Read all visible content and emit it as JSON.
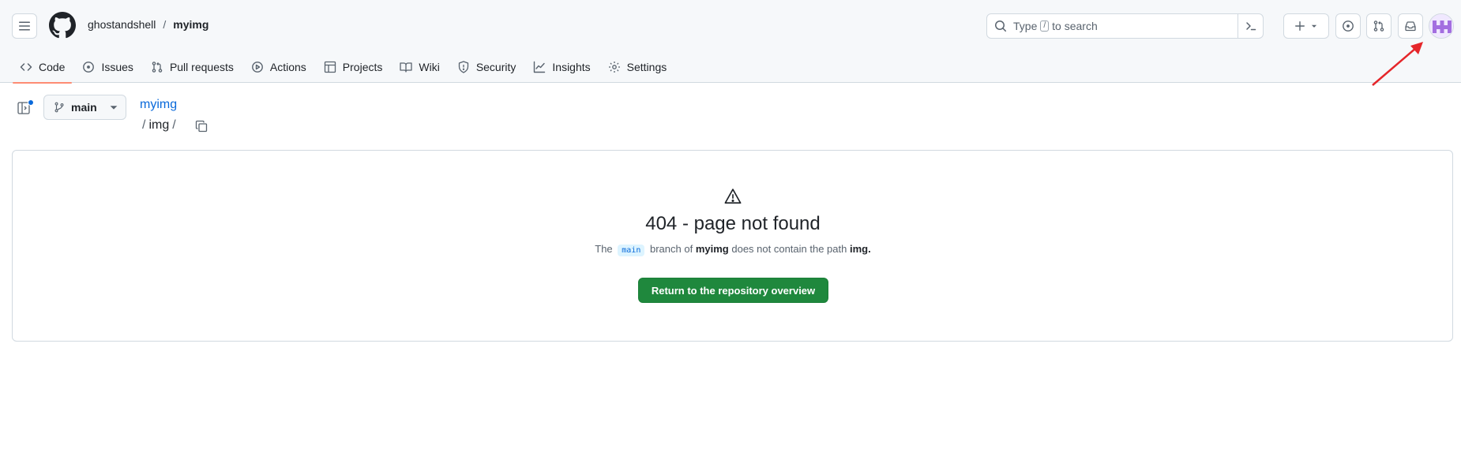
{
  "header": {
    "owner": "ghostandshell",
    "separator": "/",
    "repo": "myimg",
    "search_placeholder_pre": "Type",
    "search_key": "/",
    "search_placeholder_post": "to search",
    "plus_icon": "plus-icon",
    "icons": [
      "hamburger-icon",
      "github-logo",
      "search-icon",
      "command-palette-icon",
      "plus-icon",
      "issues-icon",
      "pull-requests-icon",
      "inbox-icon",
      "avatar"
    ]
  },
  "tabs": [
    {
      "label": "Code",
      "icon": "code-icon",
      "active": true
    },
    {
      "label": "Issues",
      "icon": "issue-opened-icon"
    },
    {
      "label": "Pull requests",
      "icon": "git-pull-request-icon"
    },
    {
      "label": "Actions",
      "icon": "play-icon"
    },
    {
      "label": "Projects",
      "icon": "table-icon"
    },
    {
      "label": "Wiki",
      "icon": "book-icon"
    },
    {
      "label": "Security",
      "icon": "shield-icon"
    },
    {
      "label": "Insights",
      "icon": "graph-icon"
    },
    {
      "label": "Settings",
      "icon": "gear-icon"
    }
  ],
  "filenav": {
    "branch": "main",
    "repo_link": "myimg",
    "path_sep": "/",
    "path": "img"
  },
  "notfound": {
    "title": "404 - page not found",
    "desc_the": "The",
    "desc_branch": "main",
    "desc_mid": "branch of",
    "desc_repo": "myimg",
    "desc_mid2": "does not contain the path",
    "desc_path": "img.",
    "button": "Return to the repository overview"
  },
  "colors": {
    "primary_button": "#1f883d",
    "link": "#0969da",
    "active_tab_underline": "#fd8c73",
    "annotation_arrow": "#e5262a"
  }
}
